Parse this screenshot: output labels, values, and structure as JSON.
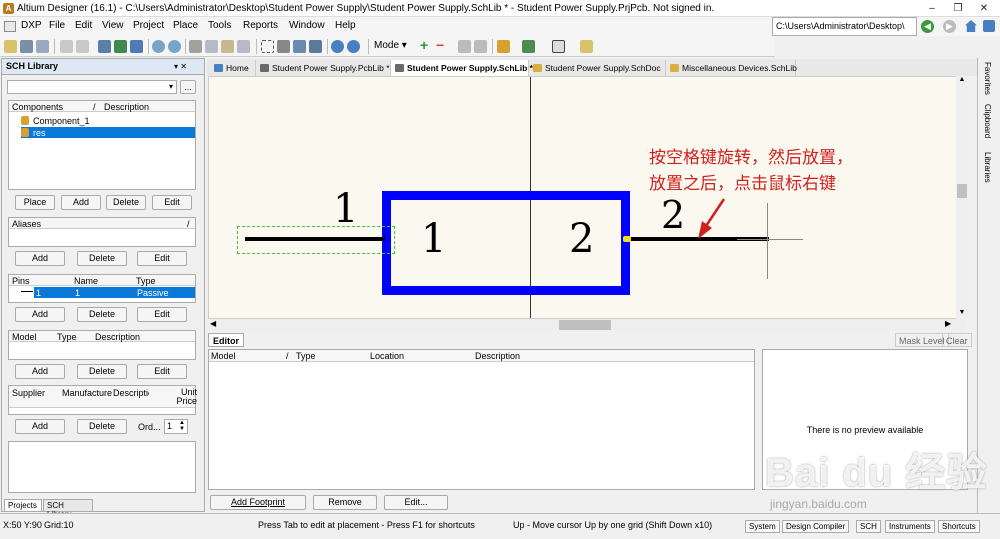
{
  "titlebar": {
    "icon": "A",
    "title": "Altium Designer (16.1) - C:\\Users\\Administrator\\Desktop\\Student Power Supply\\Student Power Supply.SchLib * - Student Power Supply.PrjPcb. Not signed in.",
    "minimize": "–",
    "restore": "❐",
    "close": "✕"
  },
  "menubar": {
    "items": [
      "DXP",
      "File",
      "Edit",
      "View",
      "Project",
      "Place",
      "Tools",
      "Reports",
      "Window",
      "Help"
    ],
    "path": "C:\\Users\\Administrator\\Desktop\\"
  },
  "toolbar": {
    "mode_label": "Mode ▾",
    "plus": "+",
    "minus": "−"
  },
  "sch_library": {
    "title": "SCH Library",
    "pin": "▾ ✕",
    "filter_btn": "...",
    "components_headers": [
      "Components",
      "/",
      "Description"
    ],
    "components": [
      "Component_1",
      "res"
    ],
    "place": "Place",
    "add": "Add",
    "delete": "Delete",
    "edit": "Edit",
    "aliases_header": "Aliases",
    "pins_headers": [
      "Pins",
      "Name",
      "Type"
    ],
    "pins_row": {
      "pin": "1",
      "name": "1",
      "type": "Passive"
    },
    "model_headers": [
      "Model",
      "Type",
      "Description"
    ],
    "supplier_headers": [
      "Supplier",
      "Manufacture",
      "Description",
      "Unit Price"
    ],
    "order_label": "Ord...",
    "order_value": "1"
  },
  "bottom_tabs": [
    "Projects",
    "SCH Library"
  ],
  "doc_tabs": [
    {
      "label": "Home",
      "color": "#4a7fc1"
    },
    {
      "label": "Student Power Supply.PcbLib *",
      "color": "#6a6a6a"
    },
    {
      "label": "Student Power Supply.SchLib *",
      "color": "#6a6a6a"
    },
    {
      "label": "Student Power Supply.SchDoc",
      "color": "#d9b040"
    },
    {
      "label": "Miscellaneous Devices.SchLib",
      "color": "#d9b040"
    }
  ],
  "canvas": {
    "pin_left_number": "1",
    "body_left_number": "1",
    "body_right_number": "2",
    "pin_right_number": "2",
    "annotation_line1": "按空格键旋转，然后放置，",
    "annotation_line2": "放置之后，点击鼠标右键",
    "colors": {
      "body": "#0000ff",
      "bg": "#fbf9ef",
      "annotation": "#d02020"
    }
  },
  "editor": {
    "tab": "Editor",
    "mask_level": "Mask Level",
    "clear": "Clear",
    "headers": [
      "Model",
      "/",
      "Type",
      "Location",
      "Description"
    ],
    "preview_text": "There is no preview available",
    "add_footprint": "Add Footprint",
    "remove": "Remove",
    "edit": "Edit..."
  },
  "right_tabs": [
    "Favorites",
    "Clipboard",
    "Libraries"
  ],
  "status": {
    "coords": "X:50 Y:90",
    "grid": "Grid:10",
    "hint": "Press Tab to edit at placement - Press F1 for shortcuts",
    "cursor": "Up - Move cursor Up by one grid (Shift Down x10)",
    "tabs": [
      "System",
      "Design Compiler",
      "SCH",
      "Instruments",
      "Shortcuts"
    ]
  },
  "watermark": {
    "brand": "Bai du 经验",
    "url": "jingyan.baidu.com"
  }
}
